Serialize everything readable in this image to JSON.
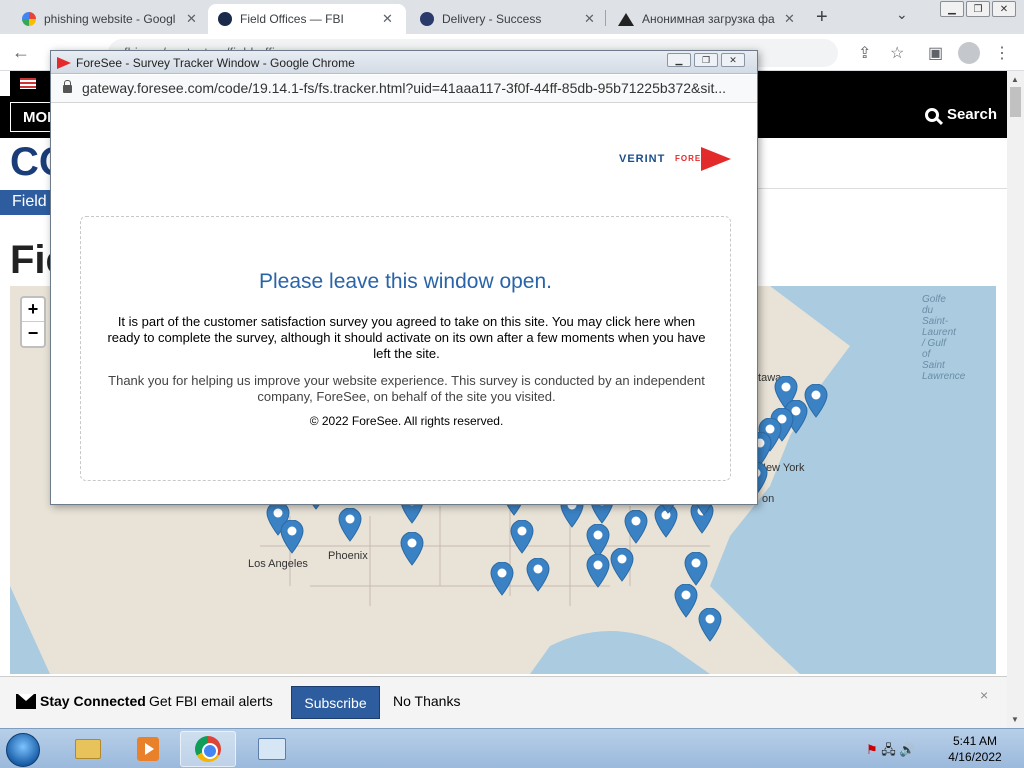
{
  "browser": {
    "tabs": [
      {
        "label": "phishing website - Googl",
        "icon": "google-icon",
        "icon_color": "#4285f4"
      },
      {
        "label": "Field Offices — FBI",
        "icon": "fbi-seal-icon",
        "icon_color": "#1a2a4a"
      },
      {
        "label": "Delivery - Success",
        "icon": "fbi-seal-icon",
        "icon_color": "#2a3a6a"
      },
      {
        "label": "Анонимная загрузка фа",
        "icon": "upload-icon",
        "icon_color": "#222222"
      }
    ],
    "address_partial": "fbi.gov/contact-us/field-offices"
  },
  "page": {
    "nav_more": "MORE",
    "nav_search": "Search",
    "title_fragment": "CO",
    "breadcrumb": "Field",
    "heading_fragment": "Fie",
    "map_labels": {
      "phoenix": "Phoenix",
      "los_angeles": "Los Angeles",
      "new_york": "New York",
      "ottawa": "ttawa",
      "boston_fragment": "on",
      "gulf_st_lawrence": "Golfe du Saint-Laurent / Gulf of Saint Lawrence",
      "st_lawrence_lines": [
        "Golfe",
        "du",
        "Saint-",
        "Laurent",
        "/ Gulf",
        "of",
        "Saint",
        "Lawrence"
      ]
    },
    "zoom_in": "+",
    "zoom_out": "−"
  },
  "stay_connected": {
    "title": "Stay Connected",
    "text": "Get FBI email alerts",
    "subscribe": "Subscribe",
    "no_thanks": "No Thanks",
    "close": "×"
  },
  "popup": {
    "window_title": "ForeSee - Survey Tracker Window - Google Chrome",
    "url": "gateway.foresee.com/code/19.14.1-fs/fs.tracker.html?uid=41aaa117-3f0f-44ff-85db-95b71225b372&sit...",
    "brand_verint": "VERINT",
    "brand_foresee": "FORESEE",
    "heading": "Please leave this window open.",
    "paragraph1": "It is part of the customer satisfaction survey you agreed to take on this site. You may click here when ready to complete the survey, although it should activate on its own after a few moments when you have left the site.",
    "paragraph2": "Thank you for helping us improve your website experience. This survey is conducted by an independent company, ForeSee, on behalf of the site you visited.",
    "copyright": "© 2022 ForeSee. All rights reserved."
  },
  "taskbar": {
    "time": "5:41 AM",
    "date": "4/16/2022"
  },
  "colors": {
    "fbi_blue": "#2d5d9f",
    "pin_blue": "#3b82c4",
    "popup_heading": "#2a64a8",
    "foresee_red": "#e32b2b"
  }
}
